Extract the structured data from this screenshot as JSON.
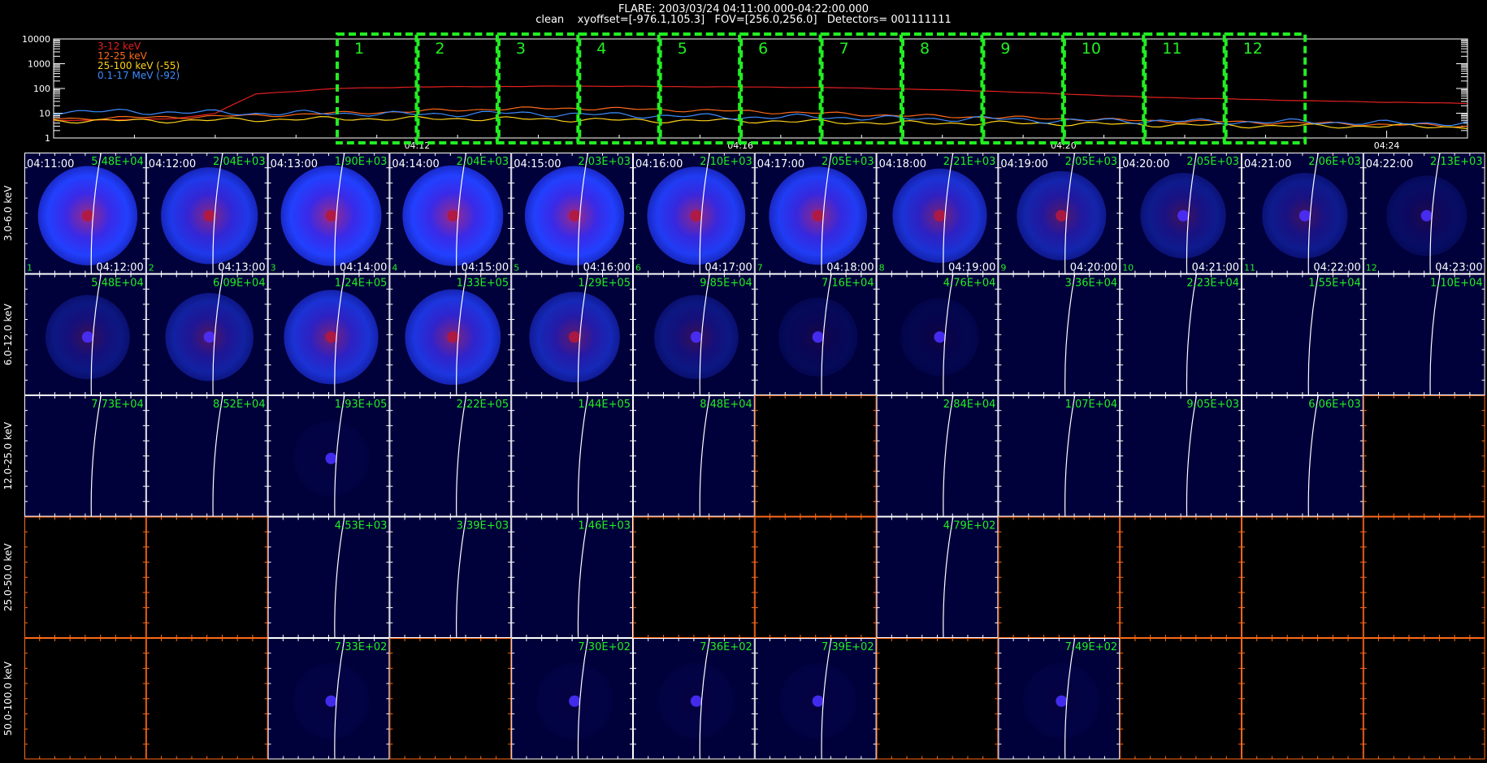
{
  "header": {
    "line1": "FLARE: 2003/03/24 04:11:00.000-04:22:00.000",
    "line2": "clean    xyoffset=[-976.1,105.3]   FOV=[256.0,256.0]   Detectors= 001111111"
  },
  "chart_data": [
    {
      "type": "line",
      "y_scale": "log",
      "ylim": [
        1,
        10000
      ],
      "y_ticks": [
        "1",
        "10",
        "100",
        "1000",
        "10000"
      ],
      "x_range": [
        "04:07:30",
        "04:25:00"
      ],
      "x_ticks": [
        "04:12",
        "04:16",
        "04:20",
        "04:24"
      ],
      "series": [
        {
          "name": "3-12 keV",
          "color": "#e32020",
          "t": [
            "04:07:30",
            "04:09:00",
            "04:09:30",
            "04:10:00",
            "04:11:00",
            "04:12:00",
            "04:13:00",
            "04:14:00",
            "04:15:00",
            "04:16:00",
            "04:17:00",
            "04:18:00",
            "04:19:00",
            "04:20:00",
            "04:21:00",
            "04:22:00",
            "04:23:00",
            "04:24:00",
            "04:25:00"
          ],
          "y": [
            5,
            6,
            10,
            60,
            100,
            115,
            120,
            125,
            120,
            115,
            110,
            95,
            80,
            60,
            45,
            38,
            32,
            28,
            25
          ]
        },
        {
          "name": "12-25 keV",
          "color": "#ff6a1a",
          "t": [
            "04:07:30",
            "04:09:00",
            "04:10:00",
            "04:11:00",
            "04:12:00",
            "04:13:00",
            "04:14:00",
            "04:15:00",
            "04:16:00",
            "04:17:00",
            "04:18:00",
            "04:19:00",
            "04:20:00",
            "04:21:00",
            "04:22:00",
            "04:23:00",
            "04:24:00",
            "04:25:00"
          ],
          "y": [
            6,
            7,
            8,
            10,
            12,
            15,
            16,
            14,
            12,
            10,
            8,
            7,
            6,
            5,
            4.5,
            4,
            3.5,
            3
          ]
        },
        {
          "name": "25-100 keV (-55)",
          "color": "#ffd21a",
          "t": [
            "04:07:30",
            "04:09:00",
            "04:10:00",
            "04:11:00",
            "04:12:00",
            "04:13:00",
            "04:14:00",
            "04:15:00",
            "04:16:00",
            "04:17:00",
            "04:18:00",
            "04:19:00",
            "04:20:00",
            "04:21:00",
            "04:22:00",
            "04:23:00",
            "04:24:00",
            "04:25:00"
          ],
          "y": [
            5,
            5,
            5.5,
            6,
            6,
            6,
            5.5,
            5,
            5,
            4.5,
            4,
            4,
            3.8,
            3.5,
            3.2,
            3,
            3,
            2.8
          ]
        },
        {
          "name": "0.1-17 MeV (-92)",
          "color": "#3d8bff",
          "t": [
            "04:07:30",
            "04:09:00",
            "04:10:00",
            "04:11:00",
            "04:12:00",
            "04:13:00",
            "04:14:00",
            "04:15:00",
            "04:16:00",
            "04:17:00",
            "04:18:00",
            "04:19:00",
            "04:20:00",
            "04:21:00",
            "04:22:00",
            "04:23:00",
            "04:24:00",
            "04:25:00"
          ],
          "y": [
            12,
            11,
            10,
            10,
            9,
            10,
            9,
            8,
            7,
            7,
            6,
            6,
            5,
            5,
            4.5,
            4.5,
            4,
            4
          ]
        }
      ],
      "intervals": {
        "labels": [
          "1",
          "2",
          "3",
          "4",
          "5",
          "6",
          "7",
          "8",
          "9",
          "10",
          "11",
          "12"
        ],
        "start": "04:11:00",
        "end": "04:23:00",
        "color": "#22ee22"
      }
    },
    {
      "type": "image-grid",
      "rows": [
        "3.0-6.0 keV",
        "6.0-12.0 keV",
        "12.0-25.0 keV",
        "25.0-50.0 keV",
        "50.0-100.0 keV"
      ],
      "cols": 12,
      "time_start": [
        "04:11:00",
        "04:12:00",
        "04:13:00",
        "04:14:00",
        "04:15:00",
        "04:16:00",
        "04:17:00",
        "04:18:00",
        "04:19:00",
        "04:20:00",
        "04:21:00",
        "04:22:00"
      ],
      "time_end": [
        "04:12:00",
        "04:13:00",
        "04:14:00",
        "04:15:00",
        "04:16:00",
        "04:17:00",
        "04:18:00",
        "04:19:00",
        "04:20:00",
        "04:21:00",
        "04:22:00",
        "04:23:00"
      ],
      "interval_labels": [
        "1",
        "2",
        "3",
        "4",
        "5",
        "6",
        "7",
        "8",
        "9",
        "10",
        "11",
        "12"
      ],
      "peaks": [
        [
          "5.48E+04",
          "2.04E+03",
          "1.90E+03",
          "2.04E+03",
          "2.03E+03",
          "2.10E+03",
          "2.05E+03",
          "2.21E+03",
          "2.05E+03",
          "2.05E+03",
          "2.06E+03",
          "2.13E+03"
        ],
        [
          "5.48E+04",
          "6.09E+04",
          "1.24E+05",
          "1.33E+05",
          "1.29E+05",
          "9.85E+04",
          "7.16E+04",
          "4.76E+04",
          "3.36E+04",
          "2.23E+04",
          "1.55E+04",
          "1.10E+04"
        ],
        [
          "7.73E+04",
          "8.52E+04",
          "1.93E+05",
          "2.22E+05",
          "1.44E+05",
          "8.48E+04",
          "",
          "2.84E+04",
          "1.07E+04",
          "9.05E+03",
          "6.06E+03",
          ""
        ],
        [
          "",
          "",
          "4.53E+03",
          "3.39E+03",
          "1.46E+03",
          "",
          "",
          "4.79E+02",
          "",
          "",
          "",
          ""
        ],
        [
          "",
          "",
          "7.33E+02",
          "",
          "7.30E+02",
          "7.36E+02",
          "7.39E+02",
          "",
          "7.49E+02",
          "",
          "",
          ""
        ]
      ],
      "images": [
        [
          0.95,
          0.85,
          1.0,
          1.0,
          0.95,
          0.9,
          0.9,
          0.75,
          0.55,
          0.4,
          0.4,
          0.2
        ],
        [
          0.35,
          0.5,
          0.75,
          0.8,
          0.6,
          0.35,
          0.15,
          0.1,
          0.0,
          0.0,
          0.0,
          0.0
        ],
        [
          0.0,
          0.0,
          0.05,
          0.0,
          0.0,
          0.0,
          null,
          0.0,
          0.0,
          0.0,
          0.0,
          null
        ],
        [
          null,
          null,
          0.0,
          0.0,
          0.0,
          null,
          null,
          0.0,
          null,
          null,
          null,
          null
        ],
        [
          null,
          null,
          0.05,
          null,
          0.05,
          0.05,
          0.05,
          null,
          0.05,
          null,
          null,
          null
        ]
      ],
      "colors": {
        "label": "#22ee22",
        "frame": "#ffffff",
        "empty_frame": "#ff6a1a",
        "panel_bg": "#00003a"
      }
    }
  ]
}
